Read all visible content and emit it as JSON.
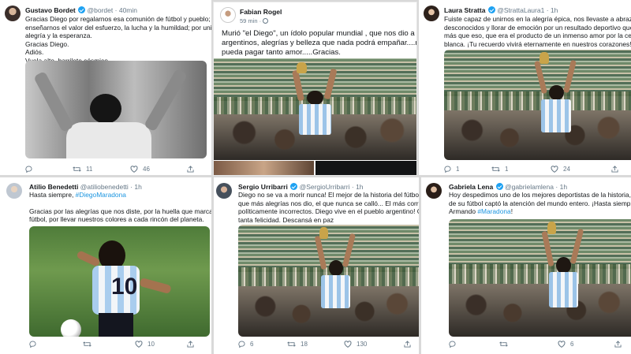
{
  "colors": {
    "background": "#d9d9d9",
    "link": "#1b95e0",
    "verified": "#1da1f2",
    "meta": "#657786"
  },
  "tweets": [
    {
      "name": "Gustavo Bordet",
      "verified": true,
      "handle": "@bordet",
      "time": "40min",
      "lines": [
        "Gracias Diego por regalarnos esa comunión de fútbol y pueblo; por",
        "enseñarnos el valor del esfuerzo, la lucha y la humildad; por unirnos en la",
        "alegría y la esperanza.",
        "Gracias Diego.",
        "Adiós.",
        "Vuela alto, barrilete cósmico."
      ],
      "replies": "",
      "retweets": "11",
      "likes": "46"
    },
    {
      "name": "Fabian Rogel",
      "time": "59 min",
      "lines": [
        "Murió \"el Diego\", un ídolo popular mundial , que nos dio a los",
        "argentinos, alegrías y belleza que nada podrá empañar....ni pueblo que",
        "pueda pagar tanto amor.....Gracias."
      ]
    },
    {
      "name": "Laura Stratta",
      "verified": true,
      "handle": "@StrattaLaura1",
      "time": "1h",
      "lines": [
        "Fuiste capaz de unirnos en la alegría épica, nos llevaste a abrazarnos con",
        "desconocidos y llorar de emoción por un resultado deportivo que era mucho",
        "más que eso, que era el producto de un inmenso amor por la celeste y",
        "blanca. ¡Tu recuerdo vivirá eternamente en nuestros corazones!"
      ],
      "replies": "1",
      "retweets": "1",
      "likes": "24"
    },
    {
      "name": "Atilio Benedetti",
      "verified": false,
      "handle": "@atiliobenedetti",
      "time": "1h",
      "line1_prefix": "Hasta siempre, ",
      "line1_tag": "#DiegoMaradona",
      "lines": [
        "Gracias por las alegrías que nos diste, por la huella que marcaste en el",
        "fútbol, por llevar nuestros colores a cada rincón del planeta."
      ],
      "replies": "",
      "retweets": "",
      "likes": "10"
    },
    {
      "name": "Sergio Urribarri",
      "verified": true,
      "handle": "@SergioUrribarri",
      "time": "1h",
      "lines": [
        "Diego no se va a morir nunca! El mejor de la historia del fútbol mundi",
        "que más alegrías nos dio, el que nunca se calló... El más correcto de lc",
        "políticamente incorrectos. Diego vive en el pueblo argentino! Gracias",
        "tanta felicidad. Descansá en paz"
      ],
      "replies": "6",
      "retweets": "18",
      "likes": "130"
    },
    {
      "name": "Gabriela Lena",
      "verified": true,
      "handle": "@gabrielamlena",
      "time": "1h",
      "lines": [
        "Hoy despedimos uno de los mejores deportistas de la historia, quie",
        "de su fútbol captó la atención del mundo entero. ¡Hasta siempre D"
      ],
      "line3_prefix": "Armando ",
      "line3_tag": "#Maradona",
      "line3_suffix": "!",
      "replies": "",
      "retweets": "",
      "likes": "6"
    }
  ]
}
